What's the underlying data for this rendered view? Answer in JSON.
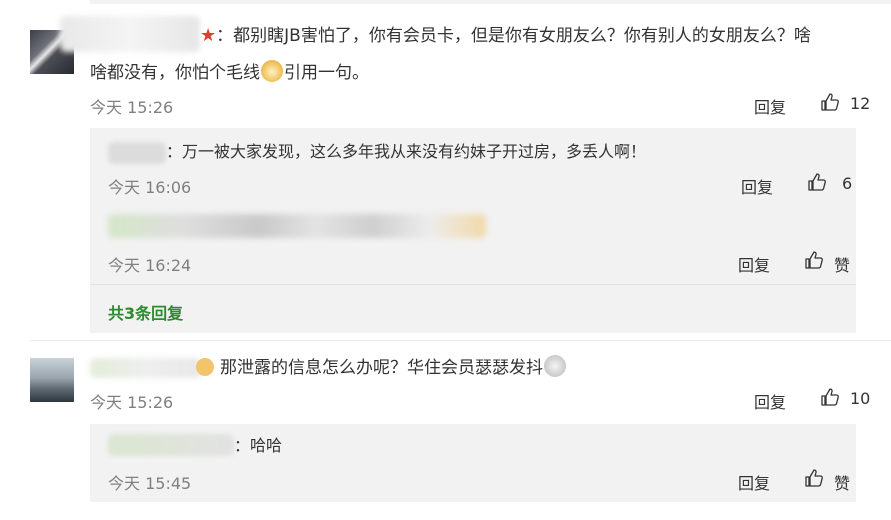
{
  "comments": [
    {
      "text_line1": "：都别瞎JB害怕了，你有会员卡，但是你有女朋友么？你有别人的女朋友么？啥",
      "text_line2_a": "啥都没有，你怕个毛线",
      "text_line2_b": "引用一句。",
      "time": "今天 15:26",
      "reply_label": "回复",
      "like_count": "12",
      "replies": [
        {
          "text": "：万一被大家发现，这么多年我从来没有约妹子开过房，多丢人啊！",
          "time": "今天 16:06",
          "reply_label": "回复",
          "like_count": "6"
        },
        {
          "text": "",
          "time": "今天 16:24",
          "reply_label": "回复",
          "like_count": "赞"
        }
      ],
      "more_replies": "共3条回复"
    },
    {
      "text": "那泄露的信息怎么办呢？华住会员瑟瑟发抖",
      "time": "今天 15:26",
      "reply_label": "回复",
      "like_count": "10",
      "replies": [
        {
          "text": "：哈哈",
          "time": "今天 15:45",
          "reply_label": "回复",
          "like_count": "赞"
        }
      ]
    }
  ],
  "icons": {
    "like": "thumbs-up-icon",
    "badge": "vip-badge-icon",
    "star": "star-icon"
  },
  "colors": {
    "link_green": "#2e8b2e",
    "reply_bg": "#f2f2f2",
    "meta_gray": "#808080"
  }
}
